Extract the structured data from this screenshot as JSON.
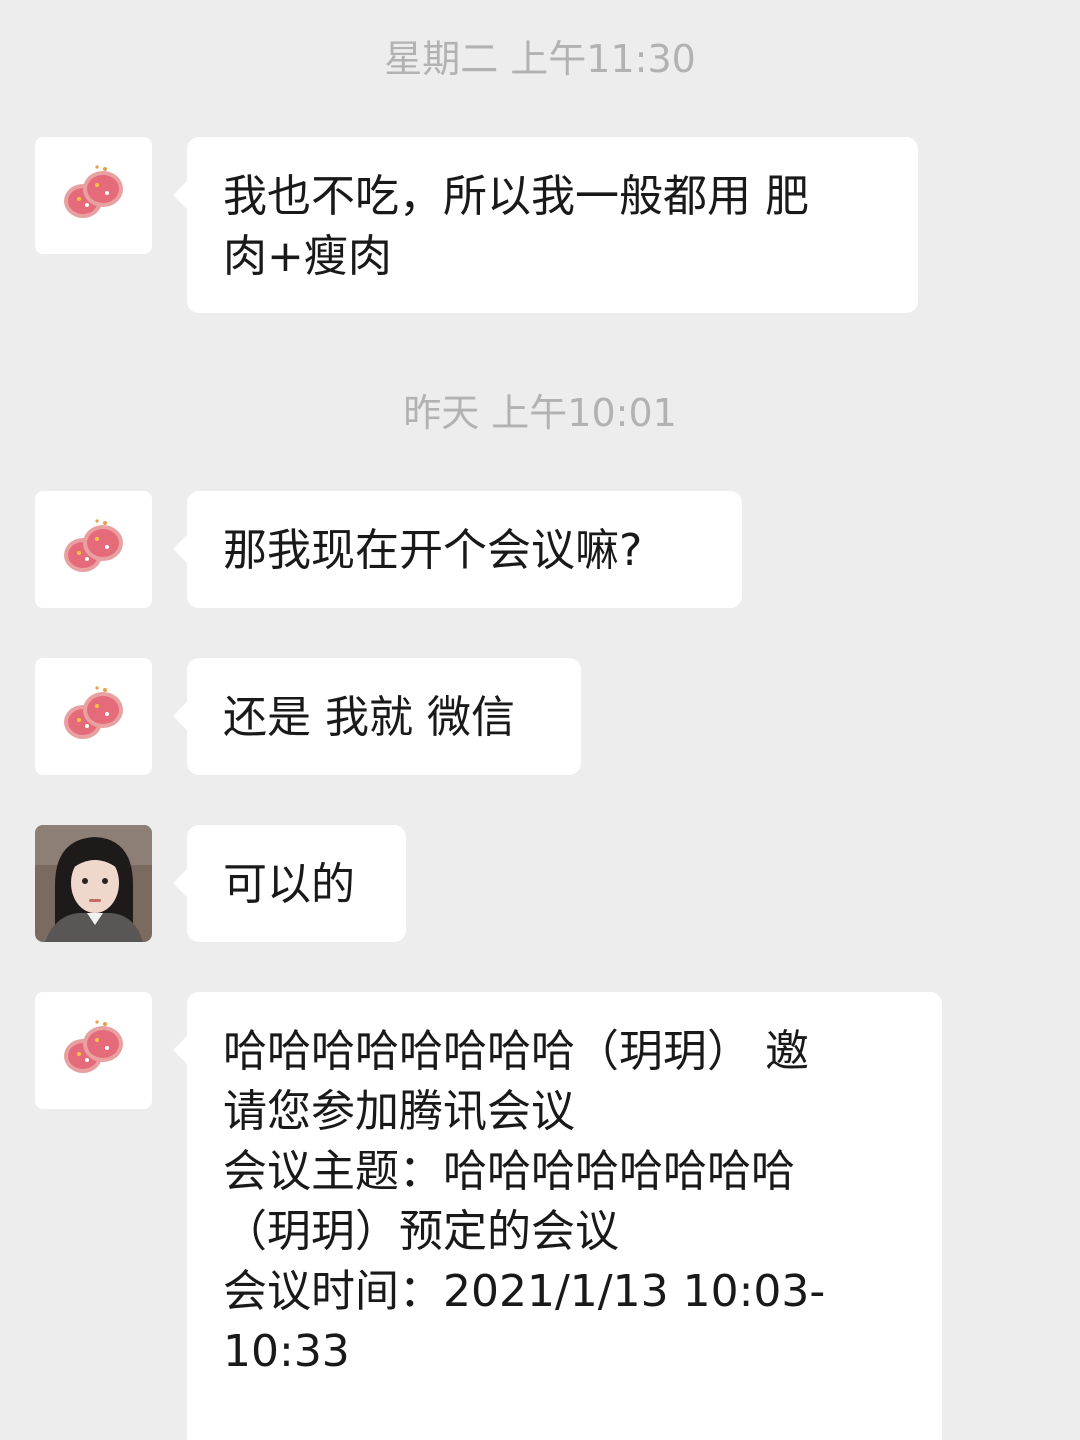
{
  "timestamps": [
    {
      "text": "星期二 上午11:30"
    },
    {
      "text": "昨天 上午10:01"
    }
  ],
  "messages": [
    {
      "sender": "donut-avatar",
      "lines": [
        "我也不吃，所以我一般都用 肥",
        "肉+瘦肉"
      ]
    },
    {
      "sender": "donut-avatar",
      "lines": [
        "那我现在开个会议嘛?"
      ]
    },
    {
      "sender": "donut-avatar",
      "lines": [
        "还是 我就 微信"
      ]
    },
    {
      "sender": "girl-avatar",
      "lines": [
        "可以的"
      ]
    },
    {
      "sender": "donut-avatar",
      "lines": [
        "哈哈哈哈哈哈哈哈（玥玥） 邀",
        "请您参加腾讯会议",
        "会议主题：哈哈哈哈哈哈哈哈",
        "（玥玥）预定的会议",
        "会议时间：2021/1/13 10:03-",
        "10:33"
      ]
    }
  ],
  "colors": {
    "background": "#ededed",
    "bubble": "#ffffff",
    "timestamp_text": "#b2b2b2",
    "message_text": "#191919"
  }
}
